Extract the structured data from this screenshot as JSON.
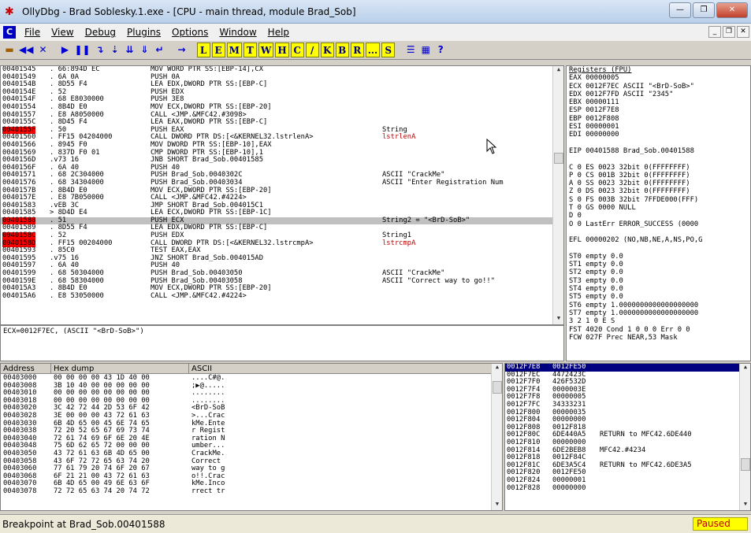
{
  "window": {
    "title": "OllyDbg - Brad Soblesky.1.exe - [CPU - main thread, module Brad_Sob]"
  },
  "menu": {
    "items": [
      "File",
      "View",
      "Debug",
      "Plugins",
      "Options",
      "Window",
      "Help"
    ]
  },
  "toolbar": {
    "letters": [
      "L",
      "E",
      "M",
      "T",
      "W",
      "H",
      "C",
      "/",
      "K",
      "B",
      "R",
      "...",
      "S"
    ]
  },
  "disasm": {
    "rows": [
      {
        "addr": "00401545",
        "hex": ". 66:894D EC",
        "instr": "MOV WORD PTR SS:[EBP-14],CX",
        "comment": ""
      },
      {
        "addr": "00401549",
        "hex": ". 6A 0A",
        "instr": "PUSH 0A",
        "comment": ""
      },
      {
        "addr": "0040154B",
        "hex": ". 8D55 F4",
        "instr": "LEA EDX,DWORD PTR SS:[EBP-C]",
        "comment": ""
      },
      {
        "addr": "0040154E",
        "hex": ". 52",
        "instr": "PUSH EDX",
        "comment": ""
      },
      {
        "addr": "0040154F",
        "hex": ". 68 E8030000",
        "instr": "PUSH 3E8",
        "comment": ""
      },
      {
        "addr": "00401554",
        "hex": ". 8B4D E0",
        "instr": "MOV ECX,DWORD PTR SS:[EBP-20]",
        "comment": ""
      },
      {
        "addr": "00401557",
        "hex": ". E8 A8050000",
        "instr": "CALL <JMP.&MFC42.#3098>",
        "comment": ""
      },
      {
        "addr": "0040155C",
        "hex": ". 8D45 F4",
        "instr": "LEA EAX,DWORD PTR SS:[EBP-C]",
        "comment": ""
      },
      {
        "addr": "0040155F",
        "hex": ". 50",
        "instr": "PUSH EAX",
        "comment": "String"
      },
      {
        "addr": "00401560",
        "hex": ". FF15 04204000",
        "instr": "CALL DWORD PTR DS:[<&KERNEL32.lstrlenA>",
        "comment": "lstrlenA"
      },
      {
        "addr": "00401566",
        "hex": ". 8945 F0",
        "instr": "MOV DWORD PTR SS:[EBP-10],EAX",
        "comment": ""
      },
      {
        "addr": "00401569",
        "hex": ". 837D F0 01",
        "instr": "CMP DWORD PTR SS:[EBP-10],1",
        "comment": ""
      },
      {
        "addr": "0040156D",
        "hex": ".v73 16",
        "instr": "JNB SHORT Brad_Sob.00401585",
        "comment": ""
      },
      {
        "addr": "0040156F",
        "hex": ". 6A 40",
        "instr": "PUSH 40",
        "comment": ""
      },
      {
        "addr": "00401571",
        "hex": ". 68 2C304000",
        "instr": "PUSH Brad_Sob.0040302C",
        "comment": "ASCII \"CrackMe\""
      },
      {
        "addr": "00401576",
        "hex": ". 68 34304000",
        "instr": "PUSH Brad_Sob.00403034",
        "comment": "ASCII \"Enter Registration Num"
      },
      {
        "addr": "0040157B",
        "hex": ". 8B4D E0",
        "instr": "MOV ECX,DWORD PTR SS:[EBP-20]",
        "comment": ""
      },
      {
        "addr": "0040157E",
        "hex": ". E8 7B050000",
        "instr": "CALL <JMP.&MFC42.#4224>",
        "comment": ""
      },
      {
        "addr": "00401583",
        "hex": ".vEB 3C",
        "instr": "JMP SHORT Brad_Sob.004015C1",
        "comment": ""
      },
      {
        "addr": "00401585",
        "hex": "> 8D4D E4",
        "instr": "LEA ECX,DWORD PTR SS:[EBP-1C]",
        "comment": ""
      },
      {
        "addr": "00401588",
        "hex": ". 51",
        "instr": "PUSH ECX",
        "comment": "String2 = \"<BrD-SoB>\""
      },
      {
        "addr": "00401589",
        "hex": ". 8D55 F4",
        "instr": "LEA EDX,DWORD PTR SS:[EBP-C]",
        "comment": ""
      },
      {
        "addr": "0040158C",
        "hex": ". 52",
        "instr": "PUSH EDX",
        "comment": "String1"
      },
      {
        "addr": "0040158D",
        "hex": ". FF15 00204000",
        "instr": "CALL DWORD PTR DS:[<&KERNEL32.lstrcmpA>",
        "comment": "lstrcmpA"
      },
      {
        "addr": "00401593",
        "hex": ". 85C0",
        "instr": "TEST EAX,EAX",
        "comment": ""
      },
      {
        "addr": "00401595",
        "hex": ".v75 16",
        "instr": "JNZ SHORT Brad_Sob.004015AD",
        "comment": ""
      },
      {
        "addr": "00401597",
        "hex": ". 6A 40",
        "instr": "PUSH 40",
        "comment": ""
      },
      {
        "addr": "00401599",
        "hex": ". 68 50304000",
        "instr": "PUSH Brad_Sob.00403050",
        "comment": "ASCII \"CrackMe\""
      },
      {
        "addr": "0040159E",
        "hex": ". 68 58304000",
        "instr": "PUSH Brad_Sob.00403058",
        "comment": "ASCII \"Correct way to go!!\""
      },
      {
        "addr": "004015A3",
        "hex": ". 8B4D E0",
        "instr": "MOV ECX,DWORD PTR SS:[EBP-20]",
        "comment": ""
      },
      {
        "addr": "004015A6",
        "hex": ". E8 53050000",
        "instr": "CALL <JMP.&MFC42.#4224>",
        "comment": ""
      }
    ]
  },
  "info": {
    "line": "ECX=0012F7EC, (ASCII \"<BrD-SoB>\")"
  },
  "registers": {
    "header": "Registers (FPU)",
    "lines": [
      "EAX 00000005",
      "ECX 0012F7EC ASCII \"<BrD-SoB>\"",
      "EDX 0012F7FD ASCII \"2345\"",
      "EBX 00000111",
      "ESP 0012F7E8",
      "EBP 0012F808",
      "ESI 00000001",
      "EDI 00000000",
      "",
      "EIP 00401588 Brad_Sob.00401588",
      "",
      "C 0  ES 0023 32bit 0(FFFFFFFF)",
      "P 0  CS 001B 32bit 0(FFFFFFFF)",
      "A 0  SS 0023 32bit 0(FFFFFFFF)",
      "Z 0  DS 0023 32bit 0(FFFFFFFF)",
      "S 0  FS 003B 32bit 7FFDE000(FFF)",
      "T 0  GS 0000 NULL",
      "D 0",
      "O 0  LastErr ERROR_SUCCESS (0000",
      "",
      "EFL 00000202 (NO,NB,NE,A,NS,PO,G",
      "",
      "ST0 empty 0.0",
      "ST1 empty 0.0",
      "ST2 empty 0.0",
      "ST3 empty 0.0",
      "ST4 empty 0.0",
      "ST5 empty 0.0",
      "ST6 empty 1.0000000000000000000",
      "ST7 empty 1.0000000000000000000",
      "               3 2 1 0      E S",
      "FST 4020  Cond 1 0 0 0  Err 0 0",
      "FCW 027F  Prec NEAR,53  Mask"
    ]
  },
  "dump": {
    "headers": {
      "address": "Address",
      "hex": "Hex dump",
      "ascii": "ASCII"
    },
    "rows": [
      {
        "addr": "00403000",
        "hex": "00 00 00 00 43 1D 40 00",
        "ascii": "....C#@."
      },
      {
        "addr": "00403008",
        "hex": "3B 10 40 00 00 00 00 00",
        "ascii": ";▶@....."
      },
      {
        "addr": "00403010",
        "hex": "00 00 00 00 00 00 00 00",
        "ascii": "........"
      },
      {
        "addr": "00403018",
        "hex": "00 00 00 00 00 00 00 00",
        "ascii": "........"
      },
      {
        "addr": "00403020",
        "hex": "3C 42 72 44 2D 53 6F 42",
        "ascii": "<BrD-SoB"
      },
      {
        "addr": "00403028",
        "hex": "3E 00 00 00 43 72 61 63",
        "ascii": ">...Crac"
      },
      {
        "addr": "00403030",
        "hex": "6B 4D 65 00 45 6E 74 65",
        "ascii": "kMe.Ente"
      },
      {
        "addr": "00403038",
        "hex": "72 20 52 65 67 69 73 74",
        "ascii": "r Regist"
      },
      {
        "addr": "00403040",
        "hex": "72 61 74 69 6F 6E 20 4E",
        "ascii": "ration N"
      },
      {
        "addr": "00403048",
        "hex": "75 6D 62 65 72 00 00 00",
        "ascii": "umber..."
      },
      {
        "addr": "00403050",
        "hex": "43 72 61 63 6B 4D 65 00",
        "ascii": "CrackMe."
      },
      {
        "addr": "00403058",
        "hex": "43 6F 72 72 65 63 74 20",
        "ascii": "Correct "
      },
      {
        "addr": "00403060",
        "hex": "77 61 79 20 74 6F 20 67",
        "ascii": "way to g"
      },
      {
        "addr": "00403068",
        "hex": "6F 21 21 00 43 72 61 63",
        "ascii": "o!!.Crac"
      },
      {
        "addr": "00403070",
        "hex": "6B 4D 65 00 49 6E 63 6F",
        "ascii": "kMe.Inco"
      },
      {
        "addr": "00403078",
        "hex": "72 72 65 63 74 20 74 72",
        "ascii": "rrect tr"
      }
    ]
  },
  "stack": {
    "rows": [
      {
        "addr": "0012F7E8",
        "val": "0012FE50",
        "comment": ""
      },
      {
        "addr": "0012F7EC",
        "val": "4472423C",
        "comment": ""
      },
      {
        "addr": "0012F7F0",
        "val": "426F532D",
        "comment": ""
      },
      {
        "addr": "0012F7F4",
        "val": "0000003E",
        "comment": ""
      },
      {
        "addr": "0012F7F8",
        "val": "00000005",
        "comment": ""
      },
      {
        "addr": "0012F7FC",
        "val": "34333231",
        "comment": ""
      },
      {
        "addr": "0012F800",
        "val": "00000035",
        "comment": ""
      },
      {
        "addr": "0012F804",
        "val": "00000000",
        "comment": ""
      },
      {
        "addr": "0012F808",
        "val": "0012F818",
        "comment": ""
      },
      {
        "addr": "0012F80C",
        "val": "6DE440A5",
        "comment": "RETURN to MFC42.6DE440"
      },
      {
        "addr": "0012F810",
        "val": "00000000",
        "comment": ""
      },
      {
        "addr": "0012F814",
        "val": "6DE2BEB8",
        "comment": "MFC42.#4234"
      },
      {
        "addr": "0012F818",
        "val": "0012F84C",
        "comment": ""
      },
      {
        "addr": "0012F81C",
        "val": "6DE3A5C4",
        "comment": "RETURN to MFC42.6DE3A5"
      },
      {
        "addr": "0012F820",
        "val": "0012FE50",
        "comment": ""
      },
      {
        "addr": "0012F824",
        "val": "00000001",
        "comment": ""
      },
      {
        "addr": "0012F828",
        "val": "00000000",
        "comment": ""
      }
    ]
  },
  "status": {
    "text": "Breakpoint at Brad_Sob.00401588",
    "state": "Paused"
  },
  "colors": {
    "highlight_row": "#c0c0c0",
    "breakpoint_addr": "#ff0000",
    "paused_bg": "#ffff00",
    "paused_text": "#c00000",
    "register_changed": "#c00000"
  }
}
